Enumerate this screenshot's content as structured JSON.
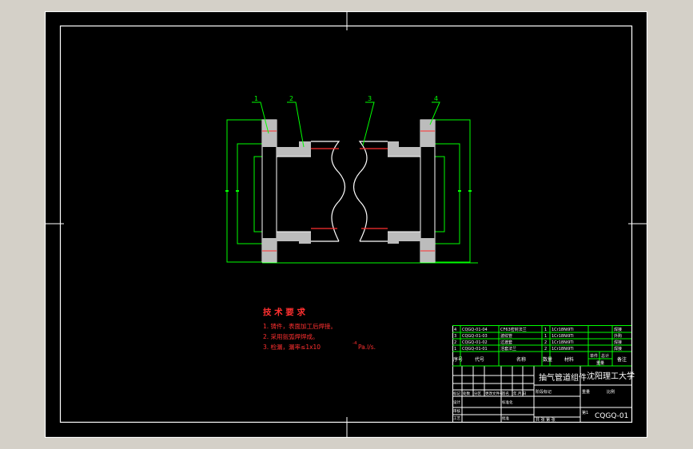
{
  "balloons": [
    "1",
    "2",
    "3",
    "4"
  ],
  "tech_requirements": {
    "title": "技 术 要 求",
    "items": [
      "1. 铸件，表面加工后焊接。",
      "2. 采用氩弧焊焊成。",
      "3. 检漏，漏率≤1x10"
    ],
    "exponent": "-4",
    "unit": "Pa.l/s."
  },
  "bom": {
    "rows": [
      {
        "no": "4",
        "code": "CQGQ-01-04",
        "name": "CF63密封法兰",
        "qty": "1",
        "material": "1Cr18Ni9Ti",
        "note": "焊接"
      },
      {
        "no": "3",
        "code": "CQGQ-01-03",
        "name": "波纹管",
        "qty": "1",
        "material": "1Cr18Ni9Ti",
        "note": "外购"
      },
      {
        "no": "2",
        "code": "CQGQ-01-02",
        "name": "过渡套",
        "qty": "2",
        "material": "1Cr18Ni9Ti",
        "note": "焊接"
      },
      {
        "no": "1",
        "code": "CQGQ-01-01",
        "name": "活套法兰",
        "qty": "2",
        "material": "1Cr18Ni9Ti",
        "note": "焊接"
      }
    ],
    "headers": {
      "no": "序号",
      "code": "代号",
      "name": "名称",
      "qty": "数量",
      "material": "材料",
      "unit_weight": "单件",
      "total_weight": "总计",
      "weight": "重量",
      "note": "备注"
    }
  },
  "title_block": {
    "drawing_title": "抽气管道组件",
    "school": "沈阳理工大学",
    "drawing_no": "CQGQ-01",
    "labels": {
      "mark": "标记",
      "count": "处数",
      "zone": "分区",
      "change_doc": "更改文件号",
      "sign": "签名",
      "date": "年.月.日",
      "design": "设计",
      "standard": "标准化",
      "check": "审核",
      "process": "工艺",
      "approve": "批准",
      "stage_mark": "阶段标记",
      "weight": "重量",
      "ratio": "比例",
      "sheets": "共 张 第 张",
      "sheet_no": "第1"
    }
  }
}
